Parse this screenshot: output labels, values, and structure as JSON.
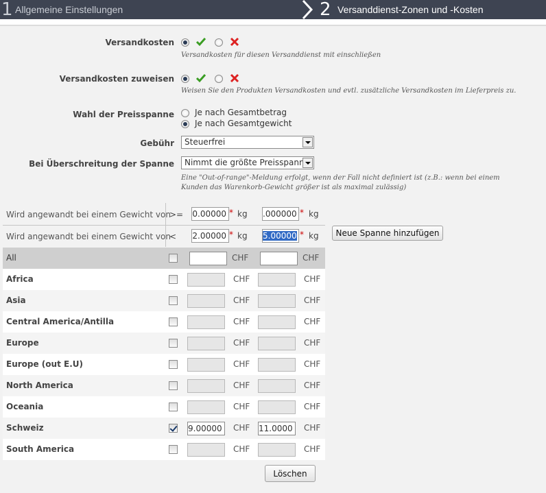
{
  "wizard": {
    "steps": [
      {
        "number": "1",
        "label": "Allgemeine Einstellungen"
      },
      {
        "number": "2",
        "label": "Versanddienst-Zonen und -Kosten"
      }
    ]
  },
  "form": {
    "shipping_costs": {
      "label": "Versandkosten",
      "help": "Versandkosten für diesen Versanddienst mit einschließen",
      "value": "yes"
    },
    "assign_costs": {
      "label": "Versandkosten zuweisen",
      "help": "Weisen Sie den Produkten Versandkosten und evtl. zusätzliche Versandkosten im Lieferpreis zu.",
      "value": "yes"
    },
    "price_range": {
      "label": "Wahl der Preisspanne",
      "options": [
        "Je nach Gesamtbetrag",
        "Je nach Gesamtgewicht"
      ],
      "selected": "Je nach Gesamtgewicht"
    },
    "fee": {
      "label": "Gebühr",
      "selected": "Steuerfrei"
    },
    "out_of_range": {
      "label": "Bei Überschreitung der Spanne",
      "selected": "Nimmt die größte Preisspanne",
      "help": "Eine \"Out-of-range\"-Meldung erfolgt, wenn der Fall nicht definiert ist (z.B.: wenn bei einem Kunden das Warenkorb-Gewicht größer ist als maximal zulässig)"
    }
  },
  "ranges": {
    "row_label": "Wird angewandt bei einem Gewicht von",
    "gte": ">=",
    "lt": "<",
    "unit": "kg",
    "from": [
      "0.00000",
      ".000000"
    ],
    "to": [
      "2.00000",
      "5.00000"
    ],
    "add_button": "Neue Spanne hinzufügen"
  },
  "zones": {
    "currency": "CHF",
    "all_label": "All",
    "rows": [
      {
        "name": "Africa",
        "checked": false,
        "v1": "",
        "v2": ""
      },
      {
        "name": "Asia",
        "checked": false,
        "v1": "",
        "v2": ""
      },
      {
        "name": "Central America/Antilla",
        "checked": false,
        "v1": "",
        "v2": ""
      },
      {
        "name": "Europe",
        "checked": false,
        "v1": "",
        "v2": ""
      },
      {
        "name": "Europe (out E.U)",
        "checked": false,
        "v1": "",
        "v2": ""
      },
      {
        "name": "North America",
        "checked": false,
        "v1": "",
        "v2": ""
      },
      {
        "name": "Oceania",
        "checked": false,
        "v1": "",
        "v2": ""
      },
      {
        "name": "Schweiz",
        "checked": true,
        "v1": "9.00000",
        "v2": "11.0000"
      },
      {
        "name": "South America",
        "checked": false,
        "v1": "",
        "v2": ""
      }
    ],
    "delete_button": "Löschen"
  }
}
